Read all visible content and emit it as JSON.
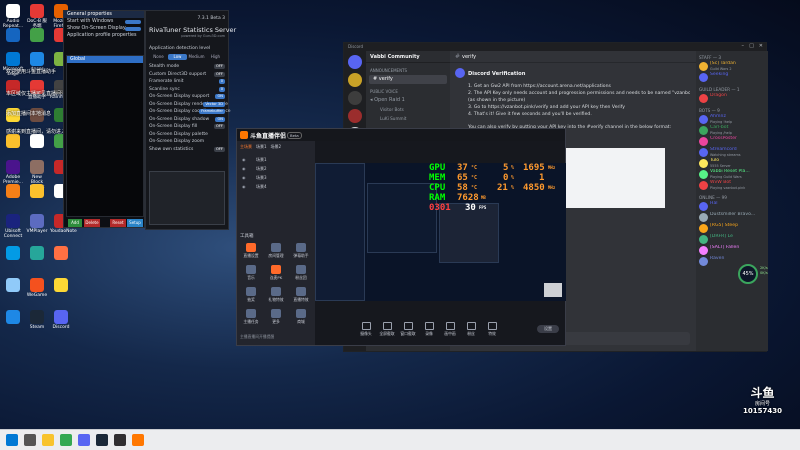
{
  "desktop": {
    "icons": [
      {
        "label": "Audio Repeat...",
        "color": "#ffffff"
      },
      {
        "label": "DoC-B 服务端",
        "color": "#e53935"
      },
      {
        "label": "Mozilla Firefox",
        "color": "#e66000"
      },
      {
        "label": "",
        "color": "#1565c0"
      },
      {
        "label": "",
        "color": "#43a047"
      },
      {
        "label": "",
        "color": "#e53935"
      },
      {
        "label": "Microsoft Edge",
        "color": "#0078d4"
      },
      {
        "label": "dnser",
        "color": "#1e88e5"
      },
      {
        "label": "",
        "color": "#7cb342"
      },
      {
        "label": "",
        "color": "#c62828"
      },
      {
        "label": "直播助手",
        "color": "#e53935"
      },
      {
        "label": "Rainmeter",
        "color": "#424242"
      },
      {
        "label": "",
        "color": "#fdd835"
      },
      {
        "label": "",
        "color": "#6d4c41"
      },
      {
        "label": "",
        "color": "#2e7d32"
      },
      {
        "label": "",
        "color": "#fbc02d"
      },
      {
        "label": "",
        "color": "#ffffff"
      },
      {
        "label": "",
        "color": "#43a047"
      },
      {
        "label": "Adobe Premie...",
        "color": "#4a148c"
      },
      {
        "label": "New Block Circuit Beta",
        "color": "#8d6e63"
      },
      {
        "label": "",
        "color": "#c62828"
      },
      {
        "label": "",
        "color": "#f57f17"
      },
      {
        "label": "",
        "color": "#fbc02d"
      },
      {
        "label": "",
        "color": "#ffffff"
      },
      {
        "label": "Ubisoft Connect",
        "color": "#1a237e"
      },
      {
        "label": "VMPlayer",
        "color": "#5c6bc0"
      },
      {
        "label": "YoudaoNote",
        "color": "#c62828"
      },
      {
        "label": "",
        "color": "#039be5"
      },
      {
        "label": "",
        "color": "#26a69a"
      },
      {
        "label": "",
        "color": "#ff7043"
      },
      {
        "label": "",
        "color": "#90caf9"
      },
      {
        "label": "WeGame",
        "color": "#f4511e"
      },
      {
        "label": "",
        "color": "#fdd835"
      },
      {
        "label": "",
        "color": "#1e88e5"
      },
      {
        "label": "Steam",
        "color": "#1b2838"
      },
      {
        "label": "Discord",
        "color": "#5865f2"
      }
    ],
    "overlay_texts": [
      "欢迎使用斗鱼直播助手",
      "本区域仅主播可见直播间消息",
      "添加直播间本地消息",
      "感谢来到直播间，请勿进入直播间"
    ]
  },
  "rivatuner": {
    "settings_title": "General properties",
    "settings_items": [
      "Start with Windows",
      "Show On-Screen Display",
      "Application profile properties"
    ],
    "selected_app": "Global",
    "buttons": {
      "add": "Add",
      "delete": "Delete",
      "reset": "Reset",
      "setup": "Setup"
    },
    "main_title": "RivaTuner Statistics Server",
    "version": "7.3.1 Beta 3",
    "subtitle": "powered by Guru3D.com",
    "detection_label": "Application detection level",
    "detection_options": [
      "None",
      "Low",
      "Medium",
      "High"
    ],
    "detection_selected": "Low",
    "options": [
      {
        "label": "Stealth mode",
        "value": "OFF"
      },
      {
        "label": "Custom Direct3D support",
        "value": "OFF"
      },
      {
        "label": "Framerate limit",
        "value": "0"
      },
      {
        "label": "Scanline sync",
        "value": "0"
      },
      {
        "label": "On-Screen Display support",
        "value": "ON"
      },
      {
        "label": "On-Screen Display rendering mode",
        "value": "Vector 3D"
      },
      {
        "label": "On-Screen Display coordinate space",
        "value": "Framebuffer"
      },
      {
        "label": "On-Screen Display shadow",
        "value": "ON"
      },
      {
        "label": "On-Screen Display fill",
        "value": "OFF"
      },
      {
        "label": "On-Screen Display palette",
        "value": ""
      },
      {
        "label": "On-Screen Display zoom",
        "value": ""
      },
      {
        "label": "Show own statistics",
        "value": "OFF"
      }
    ]
  },
  "discord": {
    "app_name": "Discord",
    "server_name": "Vabbi Community",
    "channel_header": "verify",
    "channels": [
      {
        "label": "ANNOUNCEMENTS",
        "type": "category"
      },
      {
        "label": "verify",
        "type": "channel"
      },
      {
        "label": "PUBLIC VOICE",
        "type": "category"
      },
      {
        "label": "Open Raid 1",
        "type": "voice"
      },
      {
        "label": "Visitor Bots",
        "type": "user"
      },
      {
        "label": "LuKi Summit",
        "type": "user"
      }
    ],
    "message_title": "Discord Verification",
    "messages": [
      "1. Get an Gw2 API from https://account.arena.net/applications",
      "2. The API Key only needs account and progression permissions and needs to be named \"vzanbot\"",
      "   (as shown in the picture)",
      "3. Go to https://vzanbot.pink/verify and add your API key then Verify",
      "4. That's it! Give it few seconds and you'll be verified.",
      "You can also verify by putting your API key into the #verify channel in the below format:"
    ],
    "input_placeholder": "Message #verify",
    "member_groups": [
      {
        "title": "STAFF — 3",
        "members": [
          {
            "name": "[Sc] Tardan",
            "sub": "Guild Wars 2",
            "color": "#f0b232"
          },
          {
            "name": "Seeking",
            "sub": "",
            "color": "#5865f2"
          }
        ]
      },
      {
        "title": "GUILD LEADER — 1",
        "members": [
          {
            "name": "Dragon",
            "sub": "",
            "color": "#ed4245"
          }
        ]
      },
      {
        "title": "BOTS — 9",
        "members": [
          {
            "name": "Ahmnz",
            "sub": "Playing !help",
            "color": "#5865f2"
          },
          {
            "name": "Carl-bot",
            "sub": "Playing /help",
            "color": "#3ba55d"
          },
          {
            "name": "CrossPoster",
            "sub": "",
            "color": "#eb459e"
          },
          {
            "name": "Streamcord",
            "sub": "Watching streams",
            "color": "#5865f2"
          },
          {
            "name": "Tulo",
            "sub": "5555 Server",
            "color": "#fee75c"
          },
          {
            "name": "Vabbi Reset Pla...",
            "sub": "Playing Guild Wars",
            "color": "#57f287"
          },
          {
            "name": "WvW Bot",
            "sub": "Playing vzanbot.pink",
            "color": "#ed4245"
          }
        ]
      },
      {
        "title": "ONLINE — 99",
        "members": [
          {
            "name": "Hal",
            "sub": "",
            "color": "#5865f2"
          },
          {
            "name": "Dustsmiller Bravo...",
            "sub": "",
            "color": "#99aab5"
          },
          {
            "name": "[RG5] Steep",
            "sub": "",
            "color": "#faa61a"
          },
          {
            "name": "[DRFR] Le",
            "sub": "",
            "color": "#43b581"
          },
          {
            "name": "[SALT] Fallen",
            "sub": "",
            "color": "#f47fff"
          },
          {
            "name": "Raven",
            "sub": "",
            "color": "#7289da"
          }
        ]
      }
    ]
  },
  "douyu": {
    "title": "斗鱼直播伴侣",
    "version": "Beta",
    "tabs": [
      "主场景",
      "场景1",
      "场景2"
    ],
    "scenes": [
      "场景1",
      "场景2",
      "场景3",
      "场景4"
    ],
    "tools_header": "工具箱",
    "tools": [
      "直播设置",
      "房间管理",
      "弹幕助手",
      "音乐",
      "连麦PK",
      "粉丝团",
      "抽奖",
      "礼物特效",
      "直播特效",
      "主播任务",
      "更多",
      "商城"
    ],
    "room_title": "斗鱼直播伴侣了解一下",
    "notice": "主播直播间开播提醒",
    "bottom_tools": [
      "摄像头",
      "全屏截取",
      "窗口截取",
      "录像",
      "画中画",
      "粉丝",
      "特效"
    ],
    "settings_label": "设置",
    "osd": {
      "gpu_label": "GPU",
      "gpu_temp": "37",
      "gpu_load": "5",
      "gpu_clock": "1695",
      "mem_label": "MEM",
      "mem_temp": "65",
      "mem_load": "0",
      "mem_clock": "1",
      "cpu_label": "CPU",
      "cpu_temp": "58",
      "cpu_load": "21",
      "cpu_clock": "4850",
      "ram_label": "RAM",
      "ram_value": "7628",
      "fps_a": "0301",
      "fps_b": "30"
    }
  },
  "meter": {
    "percent": "45%",
    "up": "2K/s",
    "down": "0K/s"
  },
  "watermark": {
    "brand": "斗鱼",
    "label": "房间号",
    "room_number": "10157430"
  },
  "taskbar": {
    "apps": [
      "start",
      "search",
      "explorer",
      "chrome",
      "discord",
      "steam",
      "obs",
      "douyu"
    ]
  }
}
